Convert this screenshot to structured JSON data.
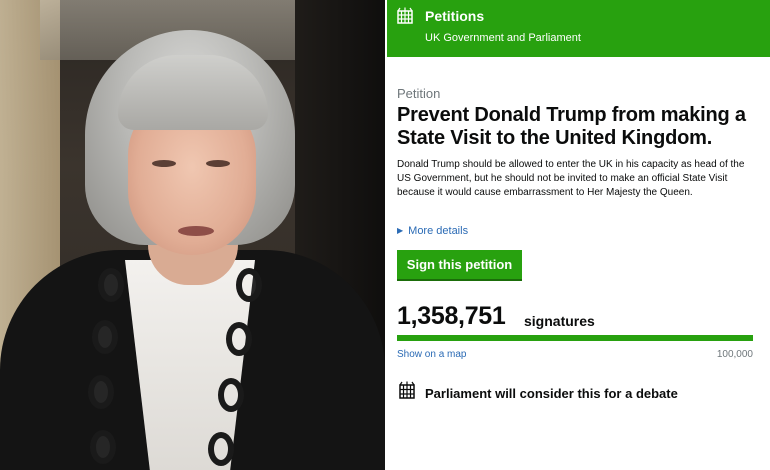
{
  "photo": {
    "description_icon": "portrait-photo"
  },
  "header": {
    "title": "Petitions",
    "subtitle": "UK Government and Parliament",
    "icon": "portcullis-icon",
    "color": "#28a10f"
  },
  "petition": {
    "kicker": "Petition",
    "title": "Prevent Donald Trump from making a State Visit to the United Kingdom.",
    "description": "Donald Trump should be allowed to enter the UK in his capacity as head of the US Government, but he should not be invited to make an official State Visit because it would cause embarrassment to Her Majesty the Queen.",
    "more_details": "More details",
    "sign_button": "Sign this petition",
    "signature_count": "1,358,751",
    "signatures_label": "signatures",
    "progress_fraction": 1.0,
    "show_map": "Show on a map",
    "threshold": "100,000",
    "debate_notice": "Parliament will consider this for a debate"
  },
  "colors": {
    "accent_green": "#28a10f",
    "link_blue": "#2b6bb5",
    "muted_text": "#6f777b"
  }
}
